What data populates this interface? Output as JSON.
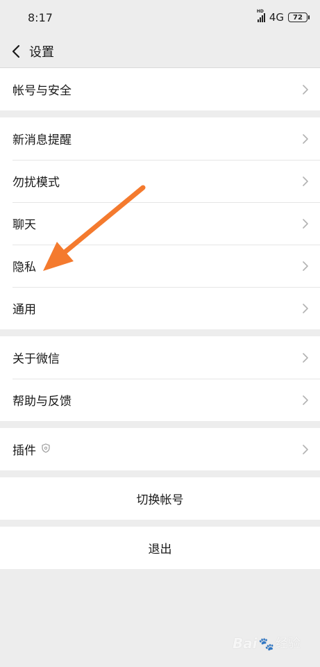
{
  "status_bar": {
    "time": "8:17",
    "network": "4G",
    "battery": "72",
    "hd": "HD"
  },
  "nav": {
    "title": "设置"
  },
  "groups": [
    {
      "items": [
        "帐号与安全"
      ]
    },
    {
      "items": [
        "新消息提醒",
        "勿扰模式",
        "聊天",
        "隐私",
        "通用"
      ]
    },
    {
      "items": [
        "关于微信",
        "帮助与反馈"
      ]
    },
    {
      "items": [
        "插件"
      ]
    }
  ],
  "actions": {
    "switch_account": "切换帐号",
    "logout": "退出"
  },
  "annotation": {
    "arrow_color": "#f47a2e"
  },
  "watermark": {
    "brand": "Bai",
    "suffix": "经验"
  }
}
